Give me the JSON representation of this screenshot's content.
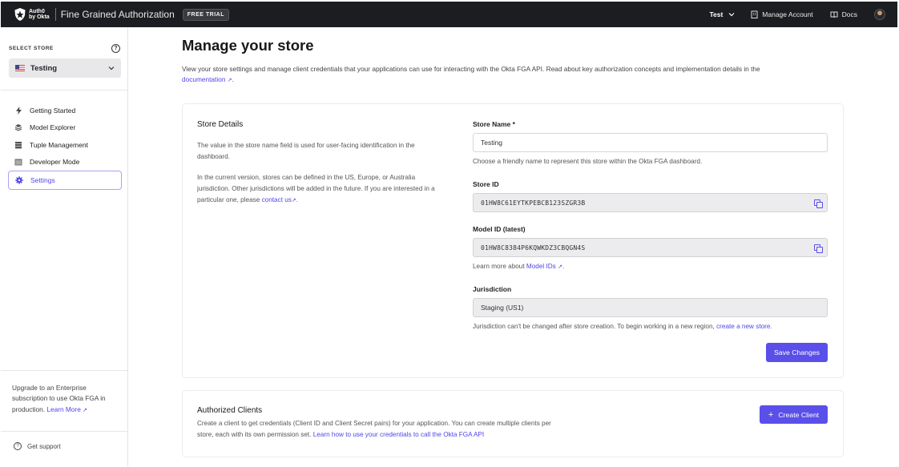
{
  "header": {
    "logo_line1": "Auth0",
    "logo_line2": "by Okta",
    "product": "Fine Grained Authorization",
    "badge": "FREE TRIAL",
    "store_selector": "Test",
    "manage_account": "Manage Account",
    "docs": "Docs"
  },
  "sidebar": {
    "select_store_label": "SELECT STORE",
    "store_value": "Testing",
    "items": [
      {
        "label": "Getting Started",
        "icon": "bolt-icon"
      },
      {
        "label": "Model Explorer",
        "icon": "layers-icon"
      },
      {
        "label": "Tuple Management",
        "icon": "database-icon"
      },
      {
        "label": "Developer Mode",
        "icon": "terminal-icon"
      },
      {
        "label": "Settings",
        "icon": "gear-icon",
        "active": true
      }
    ],
    "upgrade_text": "Upgrade to an Enterprise subscription to use Okta FGA in production.",
    "upgrade_link": "Learn More",
    "support": "Get support"
  },
  "main": {
    "title": "Manage your store",
    "intro_text": "View your store settings and manage client credentials that your applications can use for interacting with the Okta FGA API. Read about key authorization concepts and implementation details in the",
    "intro_link": "documentation",
    "store_details": {
      "title": "Store Details",
      "desc1": "The value in the store name field is used for user-facing identification in the dashboard.",
      "desc2": "In the current version, stores can be defined in the US, Europe, or Australia jurisdiction. Other jurisdictions will be added in the future. If you are interested in a particular one, please",
      "contact_link": "contact us"
    },
    "fields": {
      "store_name_label": "Store Name *",
      "store_name_value": "Testing",
      "store_name_hint": "Choose a friendly name to represent this store within the Okta FGA dashboard.",
      "store_id_label": "Store ID",
      "store_id_value": "01HW8C61EYTKPEBCB123SZGR3B",
      "model_id_label": "Model ID (latest)",
      "model_id_value": "01HW8C8384P6KQWKDZ3CBQGN4S",
      "model_hint_prefix": "Learn more about",
      "model_hint_link": "Model IDs",
      "jurisdiction_label": "Jurisdiction",
      "jurisdiction_value": "Staging (US1)",
      "jurisdiction_hint": "Jurisdiction can't be changed after store creation. To begin working in a new region,",
      "jurisdiction_link": "create a new store."
    },
    "save_button": "Save Changes",
    "clients": {
      "title": "Authorized Clients",
      "desc_line1": "Create a client to get credentials (Client ID and Client Secret pairs) for your application. You can create multiple clients per",
      "desc_line2": "store, each with its own permission set.",
      "desc_link": "Learn how to use your credentials to call the Okta FGA API",
      "create_button": "Create Client"
    }
  },
  "colors": {
    "accent": "#5a4fe9",
    "topbar": "#1c1d20",
    "link": "#4f46e5"
  }
}
